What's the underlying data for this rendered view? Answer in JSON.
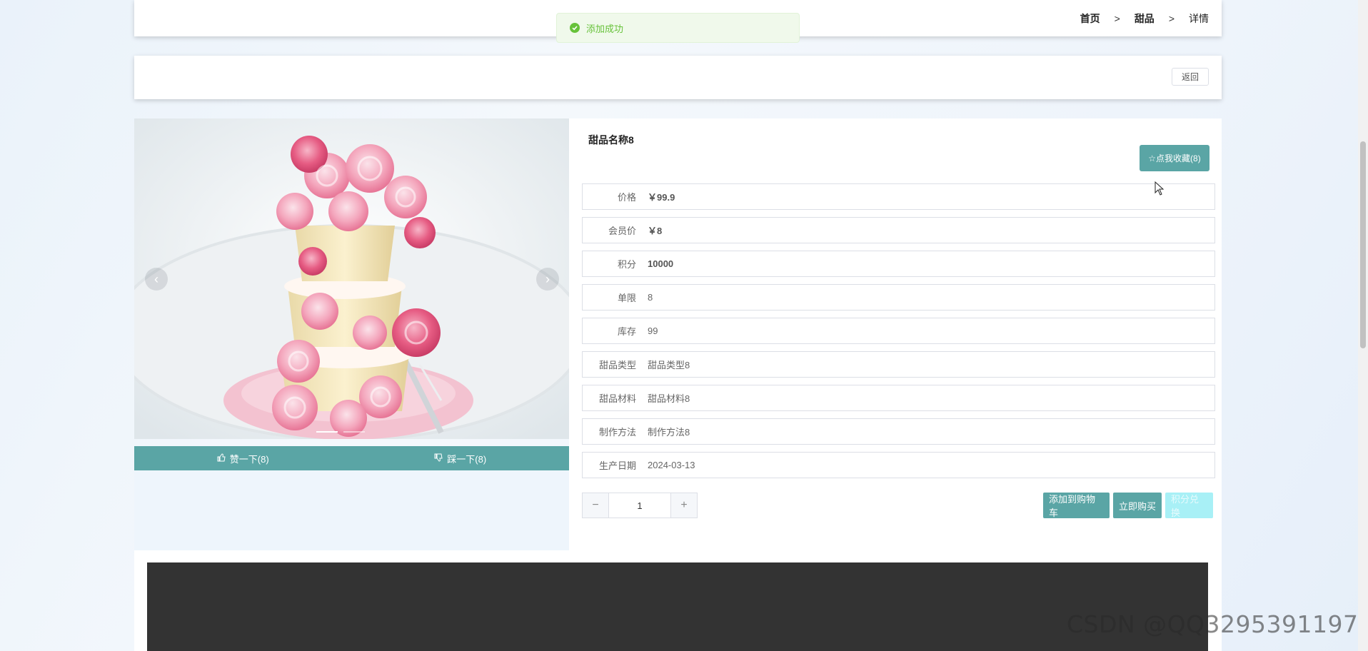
{
  "breadcrumb": {
    "home": "首页",
    "category": "甜品",
    "current": "详情",
    "separator": ">"
  },
  "toast": {
    "message": "添加成功",
    "icon": "check-circle-icon"
  },
  "actions": {
    "back_label": "返回"
  },
  "gallery": {
    "prev_icon": "chevron-left-icon",
    "next_icon": "chevron-right-icon",
    "like_label": "赞一下(8)",
    "dislike_label": "踩一下(8)"
  },
  "product": {
    "title": "甜品名称8",
    "favorite_label": "☆点我收藏(8)",
    "fields": [
      {
        "label": "价格",
        "value": "￥99.9"
      },
      {
        "label": "会员价",
        "value": "￥8"
      },
      {
        "label": "积分",
        "value": "10000"
      },
      {
        "label": "单限",
        "value": "8"
      },
      {
        "label": "库存",
        "value": "99"
      },
      {
        "label": "甜品类型",
        "value": "甜品类型8"
      },
      {
        "label": "甜品材料",
        "value": "甜品材料8"
      },
      {
        "label": "制作方法",
        "value": "制作方法8"
      },
      {
        "label": "生产日期",
        "value": "2024-03-13"
      }
    ]
  },
  "purchase": {
    "quantity": "1",
    "minus": "−",
    "plus": "+",
    "add_to_cart": "添加到购物车",
    "buy_now": "立即购买",
    "redeem_points": "积分兑换"
  },
  "watermark": "CSDN @QQ3295391197",
  "colors": {
    "accent": "#5aa5a5",
    "success": "#67c23a",
    "disabled": "#a8f0f6"
  }
}
